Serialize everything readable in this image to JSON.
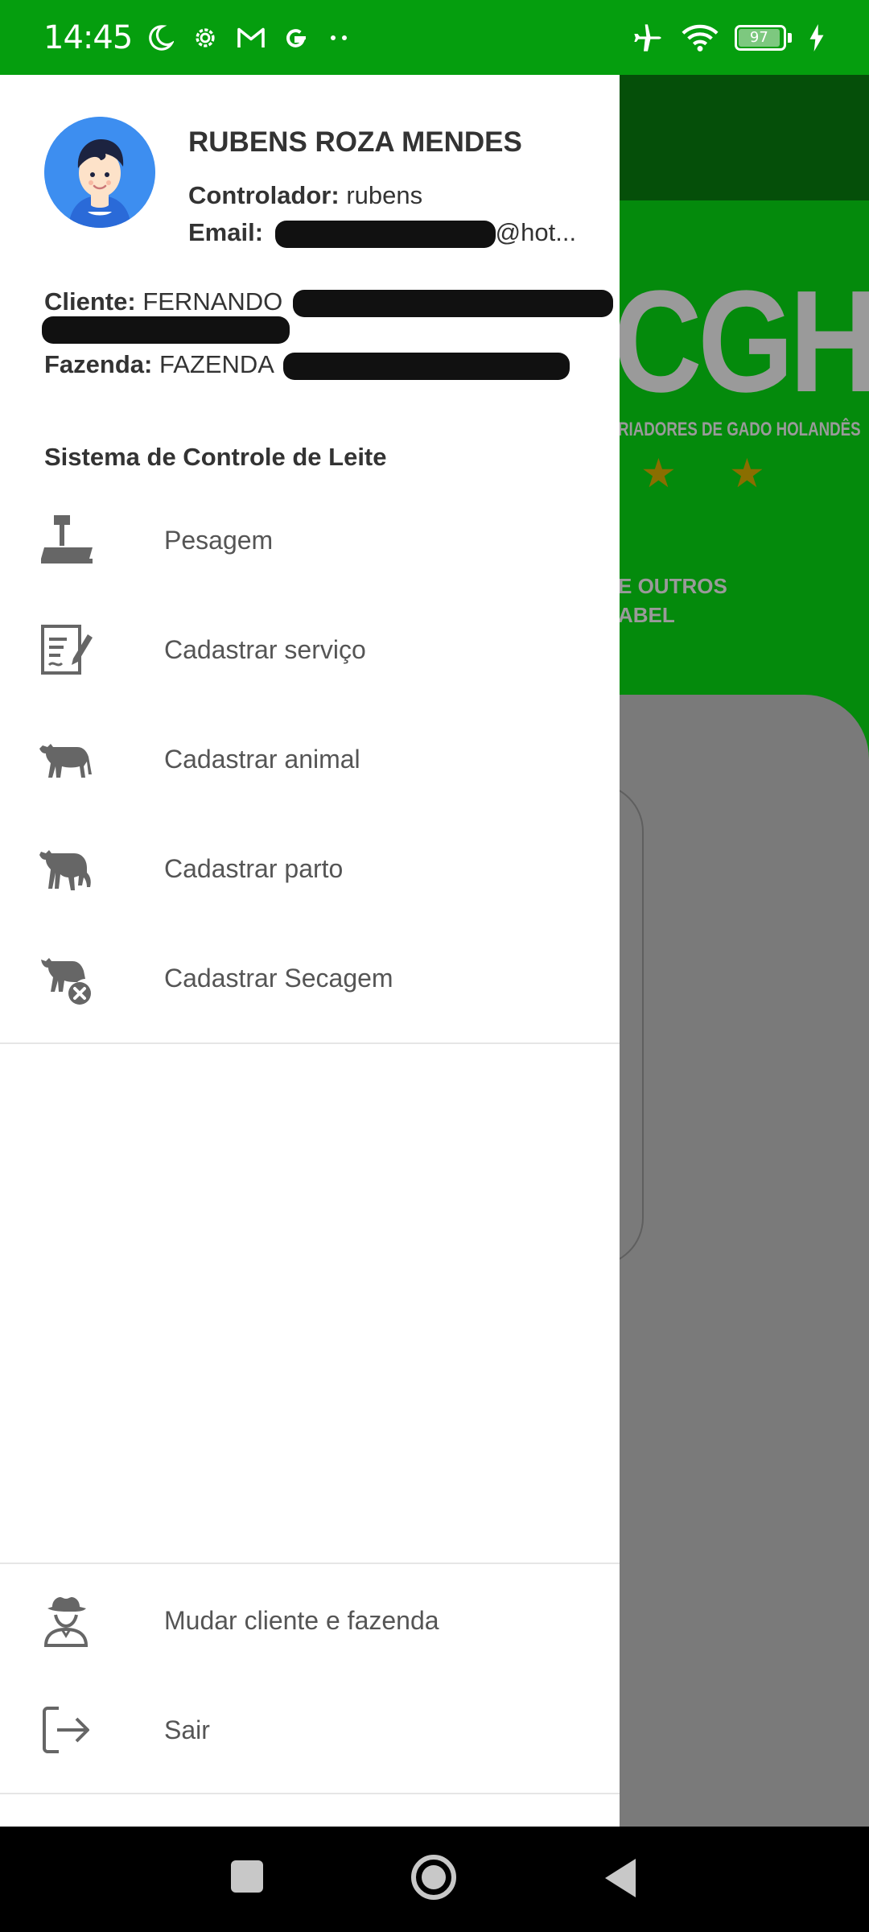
{
  "status_bar": {
    "time": "14:45",
    "icons": [
      "moon-icon",
      "gear-icon",
      "gmail-icon",
      "google-icon",
      "more-dots-icon"
    ],
    "right_icons": [
      "airplane-icon",
      "wifi-icon",
      "battery-icon",
      "charging-icon"
    ],
    "battery_level": "97",
    "background": "#059e0e"
  },
  "background_app": {
    "logo": "CGH",
    "logo_subtitle": "RIADORES DE GADO HOLANDÊS",
    "text_line1": "E OUTROS",
    "text_line2": "ABEL",
    "header_color": "#054f09",
    "green_color": "#048a0c"
  },
  "drawer": {
    "user": {
      "name": "RUBENS ROZA MENDES",
      "controller_label": "Controlador:",
      "controller_value": "rubens",
      "email_label": "Email:",
      "email_suffix": "@hot..."
    },
    "client": {
      "client_label": "Cliente:",
      "client_value": "FERNANDO",
      "farm_label": "Fazenda:",
      "farm_value": "FAZENDA"
    },
    "section_title": "Sistema de Controle de Leite",
    "menu_items": [
      {
        "label": "Pesagem",
        "icon": "scale-icon"
      },
      {
        "label": "Cadastrar serviço",
        "icon": "document-edit-icon"
      },
      {
        "label": "Cadastrar animal",
        "icon": "cow-icon"
      },
      {
        "label": "Cadastrar parto",
        "icon": "calf-birth-icon"
      },
      {
        "label": "Cadastrar Secagem",
        "icon": "cow-remove-icon"
      }
    ],
    "bottom_items": [
      {
        "label": "Mudar cliente e fazenda",
        "icon": "farmer-icon"
      },
      {
        "label": "Sair",
        "icon": "logout-icon"
      }
    ]
  },
  "nav_bar": {
    "buttons": [
      "recents-button",
      "home-button",
      "back-button"
    ]
  }
}
